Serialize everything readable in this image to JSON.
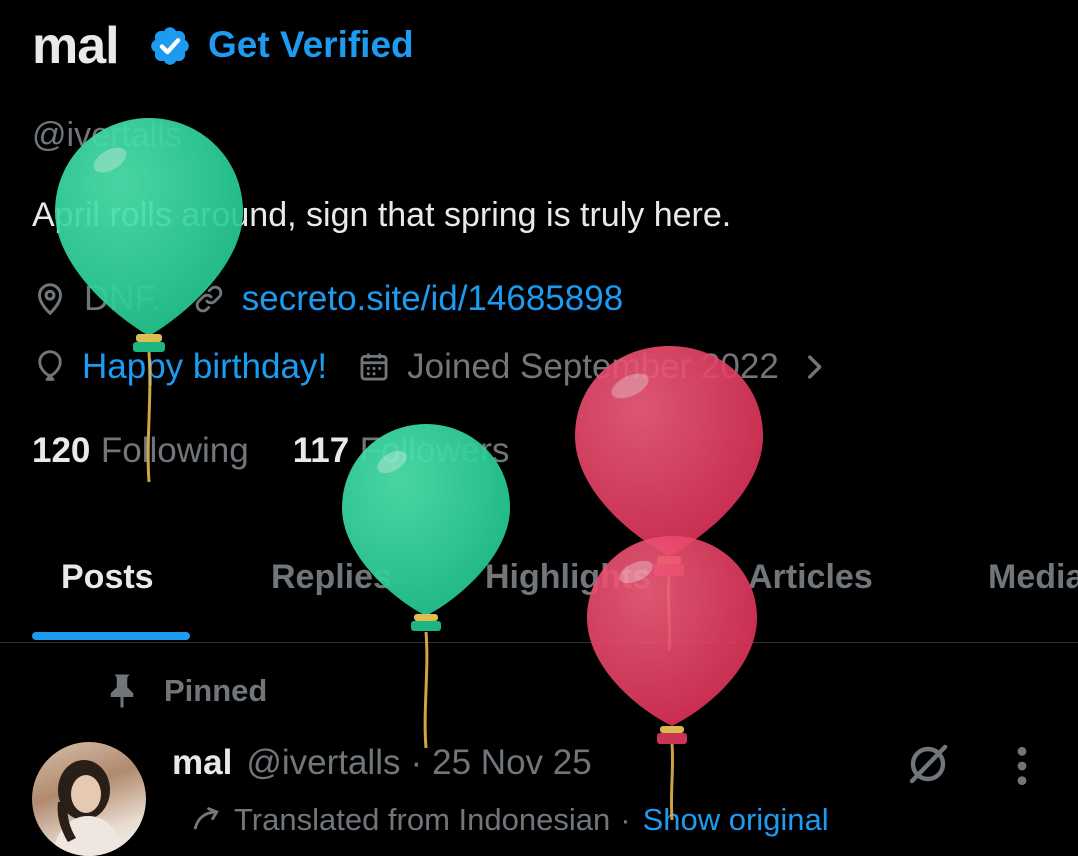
{
  "profile": {
    "name": "mal",
    "get_verified": "Get Verified",
    "handle": "@ivertalls",
    "bio": "April rolls around, sign that spring is truly here.",
    "location": "DNF.",
    "website": "secreto.site/id/14685898",
    "birthday": "Happy birthday!",
    "joined": "Joined September 2022",
    "following_count": "120",
    "following_label": "Following",
    "followers_count": "117",
    "followers_label": "Followers"
  },
  "tabs": [
    {
      "label": "Posts",
      "active": true
    },
    {
      "label": "Replies"
    },
    {
      "label": "Highlights"
    },
    {
      "label": "Articles"
    },
    {
      "label": "Media"
    }
  ],
  "pinned": {
    "label": "Pinned",
    "post": {
      "author_name": "mal",
      "author_handle": "@ivertalls",
      "separator": "·",
      "date": "25 Nov 25",
      "translated_from": "Translated from Indonesian",
      "show_original": "Show original"
    }
  },
  "icons": {
    "verified": "verified-badge-icon",
    "location": "location-pin-icon",
    "link": "link-icon",
    "birthday": "balloon-icon",
    "calendar": "calendar-icon",
    "chevron": "chevron-right-icon",
    "pin": "pin-icon",
    "grok": "grok-icon",
    "more": "more-vertical-icon",
    "translate": "translate-icon"
  },
  "colors": {
    "accent": "#1d9bf0",
    "text_primary": "#e7e9ea",
    "text_secondary": "#71767b",
    "background": "#000000",
    "balloon_green": "#2ed69c",
    "balloon_red": "#f0456f"
  }
}
